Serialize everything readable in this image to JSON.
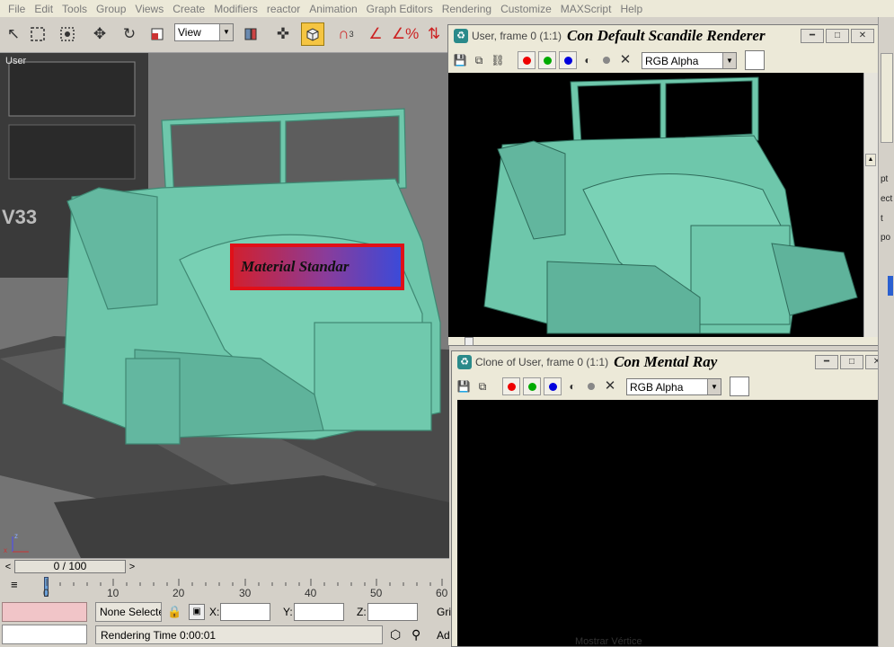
{
  "menu": [
    "File",
    "Edit",
    "Tools",
    "Group",
    "Views",
    "Create",
    "Modifiers",
    "reactor",
    "Animation",
    "Graph Editors",
    "Rendering",
    "Customize",
    "MAXScript",
    "Help"
  ],
  "toolbar": {
    "view_select": "View",
    "icons": [
      "select-arrow-icon",
      "region-select-icon",
      "select-filter-icon",
      "move-icon",
      "rotate-icon",
      "scale-icon",
      "mirror-icon",
      "pivot-icon",
      "render-teapot-icon",
      "snap-icon",
      "angle-snap-icon",
      "percent-snap-icon",
      "spinner-snap-icon"
    ]
  },
  "viewport": {
    "label": "User",
    "material_label": "Material Standar"
  },
  "time_slider": {
    "value": "0 / 100",
    "prev": "<",
    "next": ">"
  },
  "trackbar": {
    "ticks": [
      "0",
      "10",
      "20",
      "30",
      "40",
      "50",
      "60"
    ]
  },
  "status": {
    "selection": "None Selecte",
    "x_label": "X:",
    "y_label": "Y:",
    "z_label": "Z:",
    "grid_frag": "Gri",
    "add_frag": "Ad",
    "rendering_time": "Rendering Time  0:00:01"
  },
  "window1": {
    "title": "User, frame 0 (1:1)",
    "renderer": "Con Default Scandile Renderer",
    "channel": "RGB Alpha"
  },
  "window2": {
    "title": "Clone of User, frame 0 (1:1)",
    "renderer": "Con Mental Ray",
    "channel": "RGB Alpha"
  },
  "command_panel": {
    "frags": [
      "pt",
      "ect",
      "t",
      "po"
    ]
  },
  "bottom_fragment": "Mostrar Vértice"
}
